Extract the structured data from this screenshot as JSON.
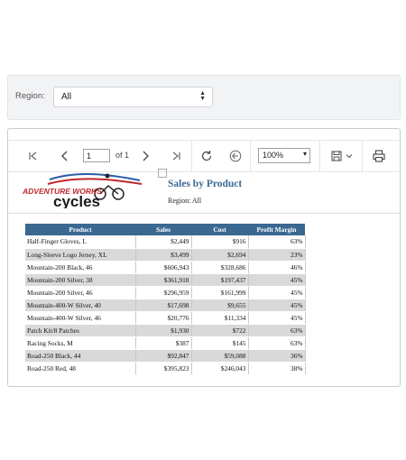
{
  "filter": {
    "label": "Region:",
    "selected": "All"
  },
  "toolbar": {
    "page_current": "1",
    "page_of": "of 1",
    "zoom": "100%"
  },
  "report": {
    "logo_text_top": "ADVENTURE WORKS",
    "logo_text_bottom": "cycles",
    "title": "Sales by Product",
    "region_line": "Region: All",
    "columns": [
      "Product",
      "Sales",
      "Cost",
      "Profit Margin"
    ],
    "rows": [
      [
        "Half-Finger Gloves, L",
        "$2,449",
        "$916",
        "63%"
      ],
      [
        "Long-Sleeve Logo Jersey, XL",
        "$3,499",
        "$2,694",
        "23%"
      ],
      [
        "Mountain-200 Black, 46",
        "$606,943",
        "$328,686",
        "46%"
      ],
      [
        "Mountain-200 Silver, 38",
        "$361,918",
        "$197,437",
        "45%"
      ],
      [
        "Mountain-200 Silver, 46",
        "$296,959",
        "$161,999",
        "45%"
      ],
      [
        "Mountain-400-W Silver, 40",
        "$17,698",
        "$9,655",
        "45%"
      ],
      [
        "Mountain-400-W Silver, 46",
        "$20,776",
        "$11,334",
        "45%"
      ],
      [
        "Patch Kit/8 Patches",
        "$1,930",
        "$722",
        "63%"
      ],
      [
        "Racing Socks, M",
        "$387",
        "$145",
        "63%"
      ],
      [
        "Road-250 Black, 44",
        "$92,847",
        "$59,088",
        "36%"
      ],
      [
        "Road-250 Red, 48",
        "$395,823",
        "$246,043",
        "38%"
      ]
    ]
  },
  "colors": {
    "header_bg": "#3a6891",
    "title": "#3b6a93",
    "logo_red": "#c0272d",
    "logo_blue": "#2b5ca8"
  }
}
